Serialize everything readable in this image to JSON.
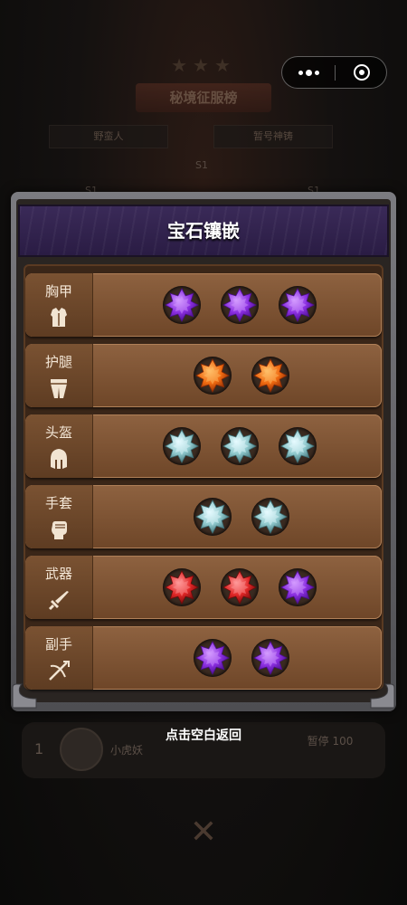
{
  "background": {
    "title": "秘境征服榜",
    "tabs": [
      "野蛮人",
      "暂号神铸"
    ],
    "season_labels": [
      "S1",
      "S1",
      "S1"
    ],
    "hint": "点击空白返回",
    "ranking_row": {
      "rank": "1",
      "name": "小虎妖",
      "score": "暂停 100"
    }
  },
  "mini_program_capsule": {
    "more_icon": "more-dots-icon",
    "close_icon": "close-target-icon"
  },
  "dialog": {
    "title": "宝石镶嵌",
    "slots": [
      {
        "label": "胸甲",
        "icon": "chest-armor-icon",
        "gems": [
          "purple",
          "purple",
          "purple"
        ]
      },
      {
        "label": "护腿",
        "icon": "leg-armor-icon",
        "gems": [
          "orange",
          "orange"
        ]
      },
      {
        "label": "头盔",
        "icon": "helmet-icon",
        "gems": [
          "cyan",
          "cyan",
          "cyan"
        ]
      },
      {
        "label": "手套",
        "icon": "glove-fist-icon",
        "gems": [
          "cyan",
          "cyan"
        ]
      },
      {
        "label": "武器",
        "icon": "sword-icon",
        "gems": [
          "red",
          "red",
          "purple"
        ]
      },
      {
        "label": "副手",
        "icon": "offhand-crossbow-icon",
        "gems": [
          "purple",
          "purple"
        ]
      }
    ]
  },
  "gem_colors": {
    "purple": {
      "light": "#d49cff",
      "mid": "#8a2ee0",
      "dark": "#4a0f8a"
    },
    "orange": {
      "light": "#ffc06a",
      "mid": "#f06a10",
      "dark": "#8a2a04"
    },
    "cyan": {
      "light": "#e6fbff",
      "mid": "#8fc8cc",
      "dark": "#3e6e74"
    },
    "red": {
      "light": "#ff9a9a",
      "mid": "#e02626",
      "dark": "#6e0a0a"
    }
  }
}
